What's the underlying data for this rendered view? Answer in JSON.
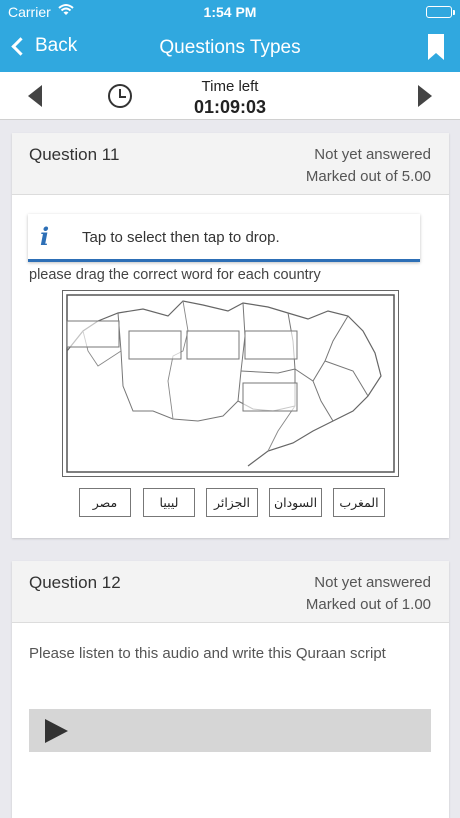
{
  "status": {
    "carrier": "Carrier",
    "time": "1:54 PM"
  },
  "nav": {
    "back_label": "Back",
    "title": "Questions Types"
  },
  "timer": {
    "label": "Time left",
    "value": "01:09:03"
  },
  "q11": {
    "title": "Question 11",
    "state": "Not yet answered",
    "marks": "Marked out of 5.00",
    "info": "Tap to select then tap to drop.",
    "prompt": "please drag the correct word for each country",
    "words": [
      "مصر",
      "ليبيا",
      "الجزائر",
      "السودان",
      "المغرب"
    ]
  },
  "q12": {
    "title": "Question 12",
    "state": "Not yet answered",
    "marks": "Marked out of 1.00",
    "prompt": "Please listen to this audio and write this Quraan script"
  },
  "colors": {
    "header_blue": "#30a8df",
    "info_blue": "#2d6fb6"
  },
  "icons": [
    "wifi-icon",
    "battery-icon",
    "chevron-left-icon",
    "bookmark-icon",
    "clock-icon",
    "prev-arrow-icon",
    "next-arrow-icon",
    "info-icon",
    "play-icon"
  ]
}
